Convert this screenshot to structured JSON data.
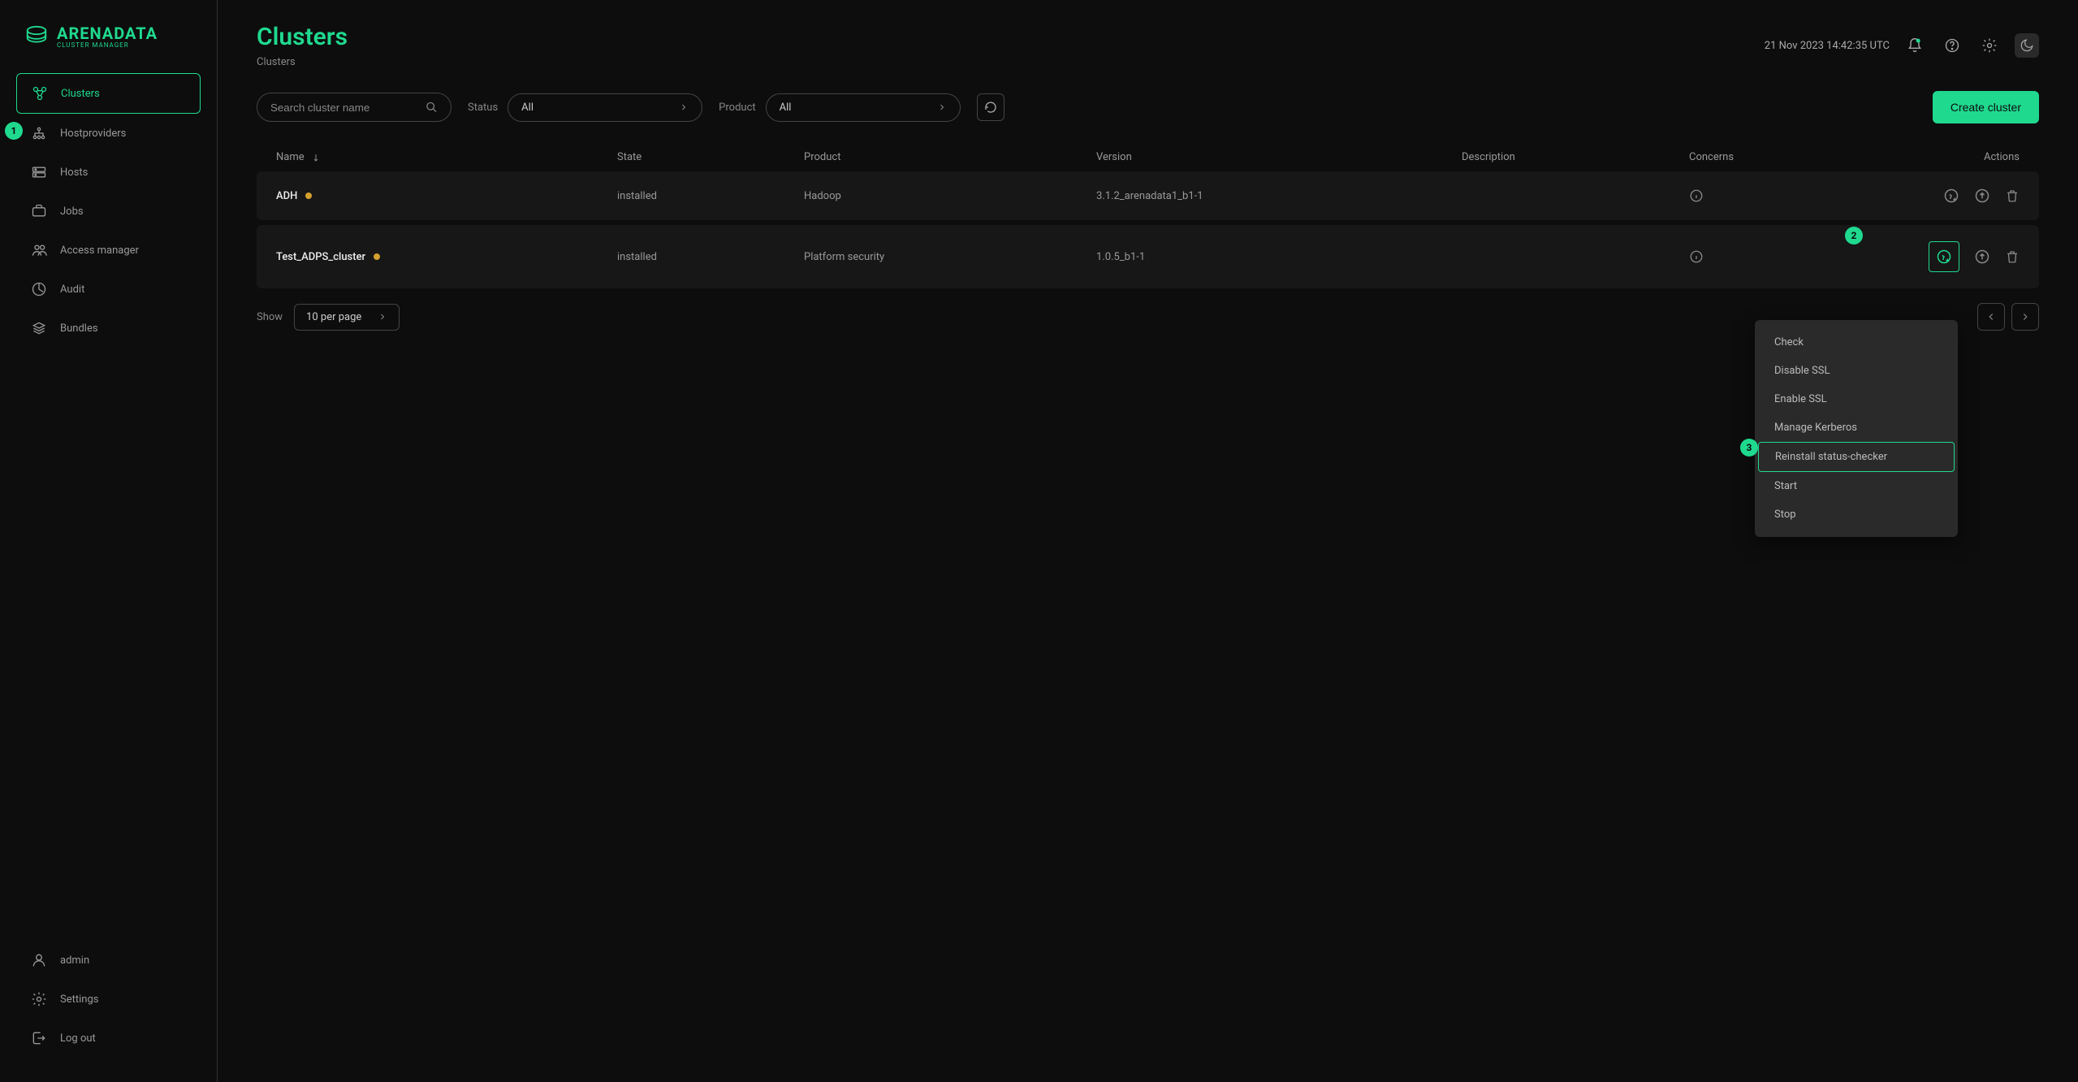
{
  "brand": {
    "name": "ARENADATA",
    "subtitle": "CLUSTER MANAGER"
  },
  "header": {
    "title": "Clusters",
    "breadcrumb": "Clusters",
    "datetime": "21 Nov 2023  14:42:35  UTC"
  },
  "sidebar": {
    "items": [
      {
        "label": "Clusters",
        "active": true
      },
      {
        "label": "Hostproviders",
        "active": false
      },
      {
        "label": "Hosts",
        "active": false
      },
      {
        "label": "Jobs",
        "active": false
      },
      {
        "label": "Access manager",
        "active": false
      },
      {
        "label": "Audit",
        "active": false
      },
      {
        "label": "Bundles",
        "active": false
      }
    ],
    "footer": [
      {
        "label": "admin"
      },
      {
        "label": "Settings"
      },
      {
        "label": "Log out"
      }
    ]
  },
  "toolbar": {
    "search_placeholder": "Search cluster name",
    "status_label": "Status",
    "status_value": "All",
    "product_label": "Product",
    "product_value": "All",
    "create_label": "Create cluster"
  },
  "table": {
    "columns": {
      "name": "Name",
      "state": "State",
      "product": "Product",
      "version": "Version",
      "description": "Description",
      "concerns": "Concerns",
      "actions": "Actions"
    },
    "rows": [
      {
        "name": "ADH",
        "state": "installed",
        "product": "Hadoop",
        "version": "3.1.2_arenadata1_b1-1",
        "description": ""
      },
      {
        "name": "Test_ADPS_cluster",
        "state": "installed",
        "product": "Platform security",
        "version": "1.0.5_b1-1",
        "description": ""
      }
    ]
  },
  "pager": {
    "show_label": "Show",
    "per_page": "10 per page"
  },
  "actions_menu": {
    "items": [
      "Check",
      "Disable SSL",
      "Enable SSL",
      "Manage Kerberos",
      "Reinstall status-checker",
      "Start",
      "Stop"
    ],
    "highlight_index": 4
  },
  "callouts": {
    "c1": "1",
    "c2": "2",
    "c3": "3"
  }
}
